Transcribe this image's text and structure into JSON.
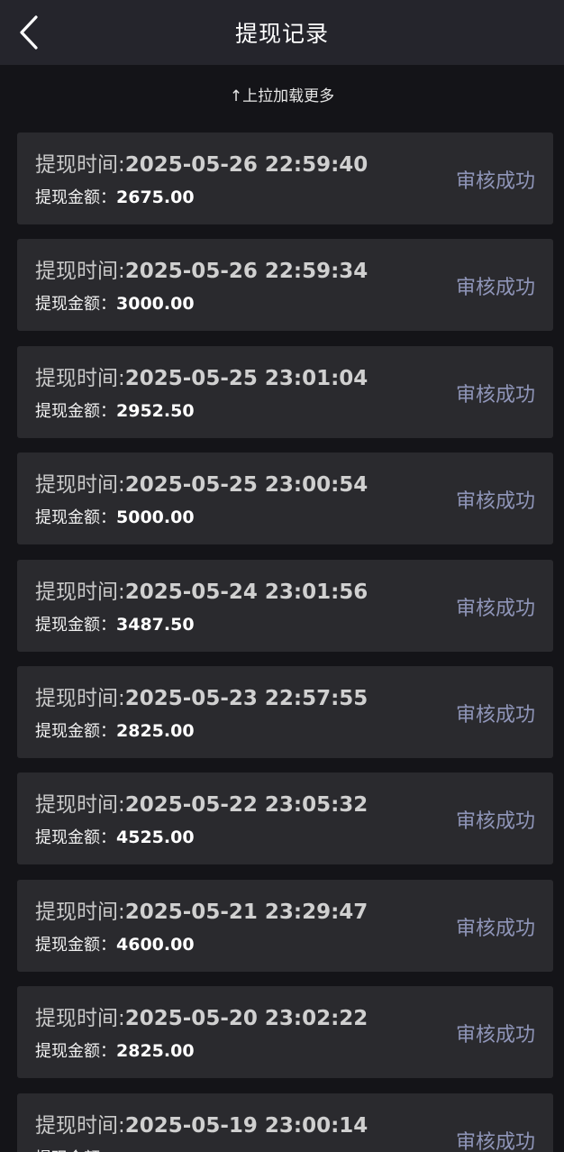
{
  "header": {
    "title": "提现记录",
    "back_icon": "chevron-left-icon"
  },
  "load_more": "↑上拉加载更多",
  "labels": {
    "time_label": "提现时间:",
    "amount_label": "提现金额："
  },
  "records": [
    {
      "time": "2025-05-26 22:59:40",
      "amount": "2675.00",
      "status": "审核成功"
    },
    {
      "time": "2025-05-26 22:59:34",
      "amount": "3000.00",
      "status": "审核成功"
    },
    {
      "time": "2025-05-25 23:01:04",
      "amount": "2952.50",
      "status": "审核成功"
    },
    {
      "time": "2025-05-25 23:00:54",
      "amount": "5000.00",
      "status": "审核成功"
    },
    {
      "time": "2025-05-24 23:01:56",
      "amount": "3487.50",
      "status": "审核成功"
    },
    {
      "time": "2025-05-23 22:57:55",
      "amount": "2825.00",
      "status": "审核成功"
    },
    {
      "time": "2025-05-22 23:05:32",
      "amount": "4525.00",
      "status": "审核成功"
    },
    {
      "time": "2025-05-21 23:29:47",
      "amount": "4600.00",
      "status": "审核成功"
    },
    {
      "time": "2025-05-20 23:02:22",
      "amount": "2825.00",
      "status": "审核成功"
    },
    {
      "time": "2025-05-19 23:00:14",
      "amount": "",
      "status": "审核成功"
    }
  ],
  "colors": {
    "background": "#141418",
    "header": "#25252c",
    "card": "#2a2a2e",
    "status": "#8f95b8"
  }
}
